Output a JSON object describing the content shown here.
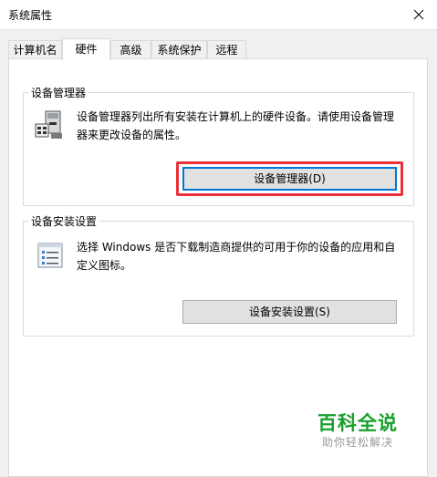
{
  "window": {
    "title": "系统属性"
  },
  "tabs": [
    {
      "label": "计算机名"
    },
    {
      "label": "硬件"
    },
    {
      "label": "高级"
    },
    {
      "label": "系统保护"
    },
    {
      "label": "远程"
    }
  ],
  "device_manager": {
    "group_label": "设备管理器",
    "description": "设备管理器列出所有安装在计算机上的硬件设备。请使用设备管理器来更改设备的属性。",
    "button_label": "设备管理器(D)"
  },
  "device_install": {
    "group_label": "设备安装设置",
    "description": "选择 Windows 是否下载制造商提供的可用于你的设备的应用和自定义图标。",
    "button_label": "设备安装设置(S)"
  },
  "watermark": {
    "title": "百科全说",
    "subtitle": "助你轻松解决"
  },
  "colors": {
    "highlight": "#e8313a",
    "focus": "#0078d7",
    "watermark": "#1aa02b"
  }
}
